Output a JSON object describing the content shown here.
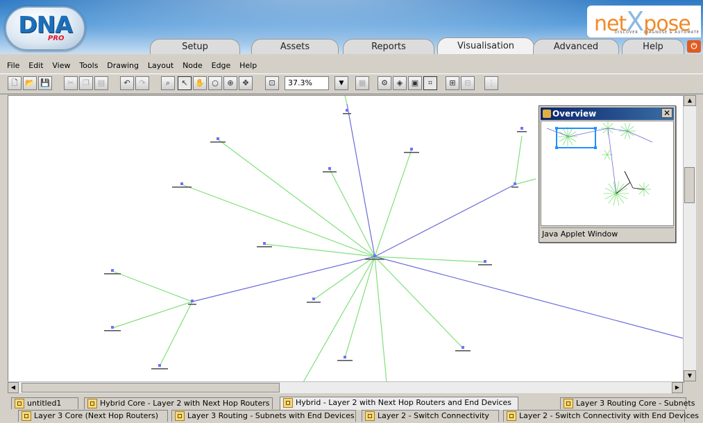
{
  "app": {
    "logo_text": "DNA",
    "logo_sub": "PRO"
  },
  "brand": {
    "name_left": "net",
    "name_x": "X",
    "name_right": "pose",
    "tagline": "DISCOVER · DIAGNOSE & AUTOMATE"
  },
  "tabs": [
    {
      "label": "Setup"
    },
    {
      "label": "Assets"
    },
    {
      "label": "Reports"
    },
    {
      "label": "Visualisation",
      "active": true
    },
    {
      "label": "Advanced"
    },
    {
      "label": "Help"
    }
  ],
  "exit_icon": "power-icon",
  "menu": [
    "File",
    "Edit",
    "View",
    "Tools",
    "Drawing",
    "Layout",
    "Node",
    "Edge",
    "Help"
  ],
  "toolbar": {
    "zoom_value": "37.3%",
    "icons": [
      "new-icon",
      "open-icon",
      "save-icon",
      "cut-icon",
      "copy-icon",
      "paste-icon",
      "undo-icon",
      "redo-icon",
      "find-icon",
      "select-icon",
      "pan-icon",
      "zoom-icon",
      "zoom-in-icon",
      "center-icon",
      "zoom-fit-icon",
      "image-icon",
      "settings-icon",
      "filter-icon",
      "layout-icon",
      "graph-icon",
      "tree-icon",
      "tree2-icon",
      "hierarchy-icon"
    ]
  },
  "overview": {
    "title": "Overview",
    "status": "Java Applet Window"
  },
  "bottom_tabs": {
    "row1": [
      "untitled1",
      "Hybrid Core - Layer 2 with Next Hop Routers",
      "Hybrid - Layer 2 with Next Hop Routers and End Devices",
      "Layer 3 Routing Core - Subnets"
    ],
    "row2": [
      "Layer 3 Core (Next Hop Routers)",
      "Layer 3 Routing - Subnets with End Devices",
      "Layer 2 - Switch Connectivity",
      "Layer 2 - Switch Connectivity with End Devices"
    ],
    "selected": "Hybrid - Layer 2 with Next Hop Routers and End Devices"
  },
  "colors": {
    "green_edge": "#7fe07a",
    "blue_edge": "#6a6ad6",
    "node": "#7070ff"
  }
}
